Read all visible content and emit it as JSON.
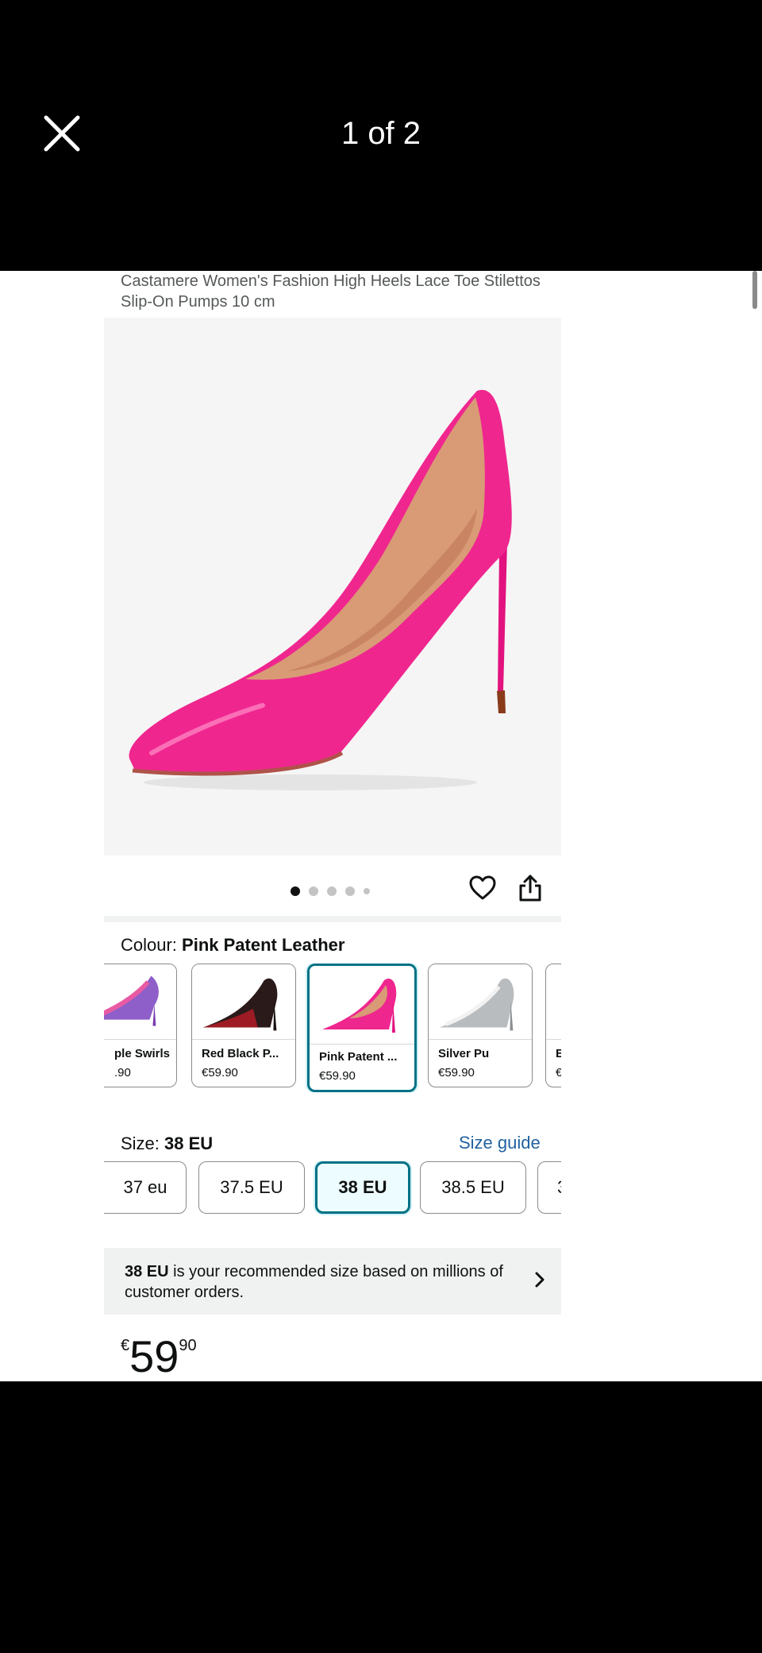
{
  "viewer": {
    "page_counter": "1 of 2",
    "close_icon": "close-icon"
  },
  "product": {
    "title": "Castamere Women's Fashion High Heels Lace Toe Stilettos Slip-On Pumps 10 cm",
    "image_dots": {
      "count": 5,
      "active_index": 0
    }
  },
  "colour": {
    "label": "Colour: ",
    "selected": "Pink Patent Leather",
    "options": [
      {
        "name": "ple Swirls",
        "price": ".90"
      },
      {
        "name": "Red Black P...",
        "price": "€59.90"
      },
      {
        "name": "Pink Patent ...",
        "price": "€59.90"
      },
      {
        "name": "Silver Pu",
        "price": "€59.90"
      },
      {
        "name": "E",
        "price": "€"
      }
    ],
    "selected_index": 2
  },
  "size": {
    "label": "Size: ",
    "selected": "38 EU",
    "guide_link": "Size guide",
    "options": [
      "37 eu",
      "37.5 EU",
      "38 EU",
      "38.5 EU",
      "3"
    ],
    "selected_index": 2
  },
  "recommendation": {
    "size": "38 EU",
    "text": " is your recommended size based on millions of customer orders."
  },
  "price": {
    "currency": "€",
    "whole": "59",
    "fraction": "90"
  },
  "colors": {
    "accent": "#007185",
    "link": "#2162a1",
    "shoe_pink": "#f0268f"
  }
}
